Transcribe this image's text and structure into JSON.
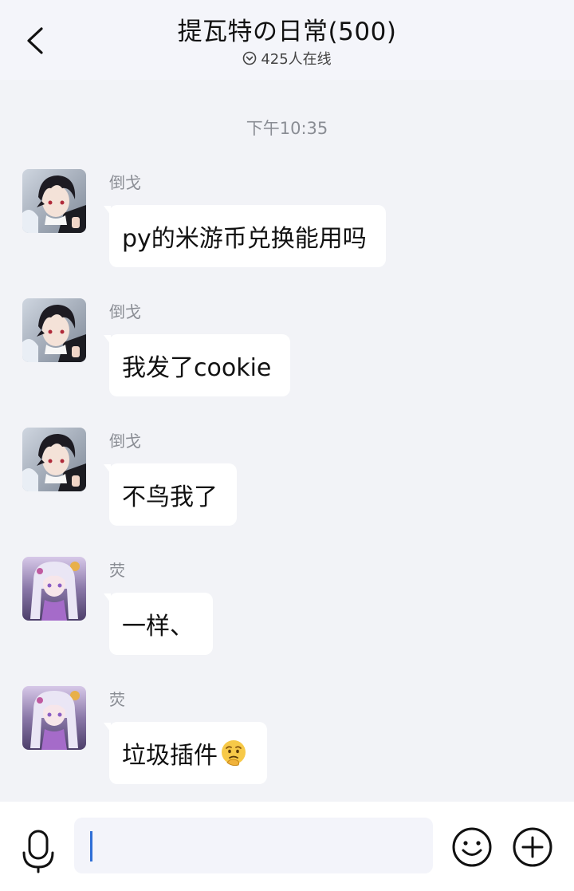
{
  "header": {
    "title": "提瓦特の日常(500)",
    "online_text": "425人在线",
    "back_icon": "chevron-left-icon",
    "status_icon": "chevron-down-circle-icon"
  },
  "chat": {
    "timestamp": "下午10:35",
    "messages": [
      {
        "sender": "倒戈",
        "text": "py的米游币兑换能用吗",
        "avatar": "dark-hair-boy-avatar"
      },
      {
        "sender": "倒戈",
        "text": "我发了cookie",
        "avatar": "dark-hair-boy-avatar"
      },
      {
        "sender": "倒戈",
        "text": "不鸟我了",
        "avatar": "dark-hair-boy-avatar"
      },
      {
        "sender": "荧",
        "text": "一样、",
        "avatar": "silver-hair-girl-avatar"
      },
      {
        "sender": "荧",
        "text": "垃圾插件",
        "avatar": "silver-hair-girl-avatar",
        "emoji": "thinking-face-emoji"
      }
    ]
  },
  "input_bar": {
    "mic_icon": "microphone-icon",
    "input_value": "",
    "emoji_icon": "smiley-icon",
    "add_icon": "plus-circle-icon"
  },
  "colors": {
    "background": "#f2f3f7",
    "bubble": "#ffffff",
    "caret": "#2f6fd6",
    "meta_text": "#8a8d94"
  }
}
